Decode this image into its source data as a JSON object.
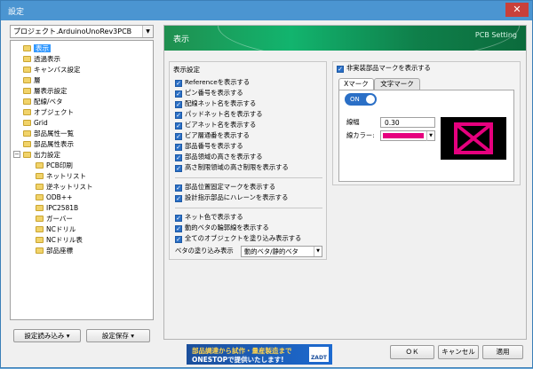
{
  "window": {
    "title": "設定",
    "close_label": "✕"
  },
  "sidebar": {
    "project": "プロジェクト.ArduinoUnoRev3PCB",
    "items": [
      {
        "label": "表示",
        "selected": true
      },
      {
        "label": "透過表示"
      },
      {
        "label": "キャンバス設定"
      },
      {
        "label": "層"
      },
      {
        "label": "層表示設定"
      },
      {
        "label": "配線/ベタ"
      },
      {
        "label": "オブジェクト"
      },
      {
        "label": "Grid"
      },
      {
        "label": "部品属性一覧"
      },
      {
        "label": "部品属性表示"
      },
      {
        "label": "出力設定",
        "expander": "−"
      },
      {
        "label": "PCB印刷"
      },
      {
        "label": "ネットリスト"
      },
      {
        "label": "逆ネットリスト"
      },
      {
        "label": "ODB++"
      },
      {
        "label": "IPC2581B"
      },
      {
        "label": "ガーバー"
      },
      {
        "label": "NCドリル"
      },
      {
        "label": "NCドリル表"
      },
      {
        "label": "部品座標"
      }
    ],
    "load_button": "設定読み込み ▾",
    "save_button": "設定保存 ▾"
  },
  "panel": {
    "title": "表示",
    "subtitle": "PCB Setting",
    "display_group": {
      "title": "表示設定",
      "checkboxes_a": [
        "Referenceを表示する",
        "ピン番号を表示する",
        "配線ネット名を表示する",
        "パッドネット名を表示する",
        "ビアネット名を表示する",
        "ビア層通番を表示する",
        "部品番号を表示する",
        "部品領域の高さを表示する",
        "高さ制限領域の高さ制限を表示する"
      ],
      "checkboxes_b": [
        "部品位置固定マークを表示する",
        "設計指示部品にハレーンを表示する"
      ],
      "checkboxes_c": [
        "ネット色で表示する",
        "動的ベタの輪郭線を表示する",
        "全てのオブジェクトを塗り込み表示する"
      ],
      "fill_label": "ベタの塗り込み表示",
      "fill_value": "動的ベタ/静的ベタ"
    },
    "mounted_group": {
      "checkbox": "非実装部品マークを表示する",
      "tab_x": "Xマーク",
      "tab_text": "文字マーク",
      "toggle": "ON",
      "line_width_label": "線幅",
      "line_width_value": "0.30",
      "line_color_label": "線カラー:",
      "line_color": "#e6007e"
    }
  },
  "promo": {
    "line1": "部品調達から試作・量産製造まで",
    "line2": "ONESTOPで提供いたします!",
    "logo": "ZADT"
  },
  "footer": {
    "ok": "ＯＫ",
    "cancel": "キャンセル",
    "apply": "適用"
  }
}
